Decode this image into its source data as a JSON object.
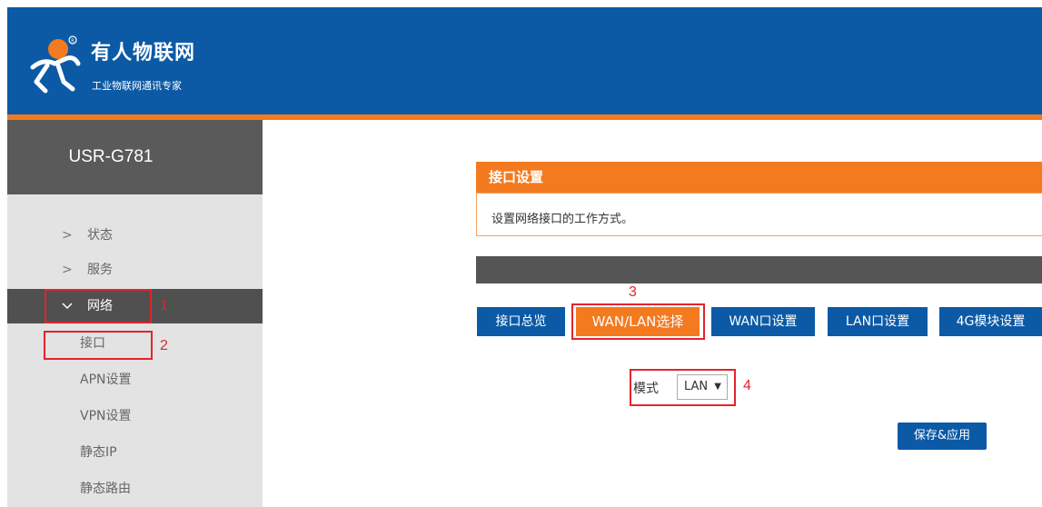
{
  "header": {
    "brand_name": "有人物联网",
    "slogan": "工业物联网通讯专家",
    "colors": {
      "header_bg": "#0c5aa6",
      "accent": "#f47a1f"
    }
  },
  "sidebar": {
    "device_name": "USR-G781",
    "menu": [
      {
        "label": "状态",
        "icon": "chevron-right-icon"
      },
      {
        "label": "服务",
        "icon": "chevron-right-icon"
      },
      {
        "label": "网络",
        "icon": "chevron-down-icon",
        "expanded": true
      }
    ],
    "submenu": [
      {
        "label": "接口",
        "selected": true
      },
      {
        "label": "APN设置"
      },
      {
        "label": "VPN设置"
      },
      {
        "label": "静态IP"
      },
      {
        "label": "静态路由"
      }
    ]
  },
  "content": {
    "section_title": "接口设置",
    "section_desc": "设置网络接口的工作方式。",
    "tabs": [
      {
        "label": "接口总览"
      },
      {
        "label": "WAN/LAN选择",
        "active": true
      },
      {
        "label": "WAN口设置"
      },
      {
        "label": "LAN口设置"
      },
      {
        "label": "4G模块设置"
      }
    ],
    "mode_label": "模式",
    "mode_value": "LAN",
    "save_label": "保存&应用"
  },
  "annotations": {
    "n1": "1",
    "n2": "2",
    "n3": "3",
    "n4": "4"
  }
}
